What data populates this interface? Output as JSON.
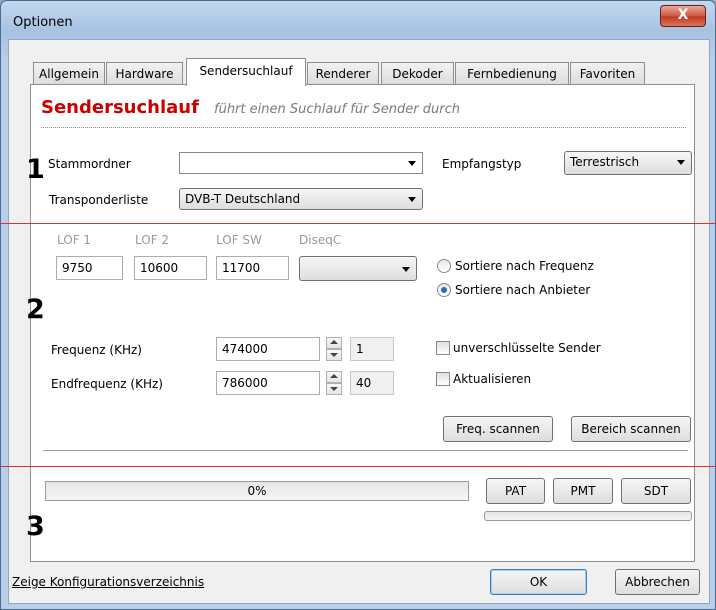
{
  "window": {
    "title": "Optionen",
    "close_glyph": "X"
  },
  "tabs": [
    {
      "label": "Allgemein"
    },
    {
      "label": "Hardware"
    },
    {
      "label": "Sendersuchlauf",
      "active": true
    },
    {
      "label": "Renderer"
    },
    {
      "label": "Dekoder"
    },
    {
      "label": "Fernbedienung"
    },
    {
      "label": "Favoriten"
    }
  ],
  "header": {
    "title": "Sendersuchlauf",
    "subtitle": "führt einen Suchlauf für Sender durch"
  },
  "section1": {
    "number": "1",
    "stammordner_label": "Stammordner",
    "stammordner_value": "",
    "transponder_label": "Transponderliste",
    "transponder_value": "DVB-T Deutschland",
    "empfangstyp_label": "Empfangstyp",
    "empfangstyp_value": "Terrestrisch"
  },
  "section2": {
    "number": "2",
    "lof1_label": "LOF 1",
    "lof1_value": "9750",
    "lof2_label": "LOF 2",
    "lof2_value": "10600",
    "lofsw_label": "LOF SW",
    "lofsw_value": "11700",
    "diseqc_label": "DiseqC",
    "diseqc_value": "",
    "sort_freq_label": "Sortiere nach Frequenz",
    "sort_anbieter_label": "Sortiere nach Anbieter",
    "sort_selected": "Sortiere nach Anbieter",
    "frequenz_label": "Frequenz (KHz)",
    "frequenz_value": "474000",
    "frequenz_channel": "1",
    "endfrequenz_label": "Endfrequenz (KHz)",
    "endfrequenz_value": "786000",
    "endfrequenz_channel": "40",
    "unverschluesselt_label": "unverschlüsselte Sender",
    "unverschluesselt_checked": false,
    "aktualisieren_label": "Aktualisieren",
    "aktualisieren_checked": false,
    "freq_scan_button": "Freq. scannen",
    "bereich_scan_button": "Bereich scannen"
  },
  "section3": {
    "number": "3",
    "progress_text": "0%",
    "progress_value": 0,
    "pat_button": "PAT",
    "pmt_button": "PMT",
    "sdt_button": "SDT"
  },
  "footer": {
    "config_link": "Zeige Konfigurationsverzeichnis",
    "ok_button": "OK",
    "cancel_button": "Abbrechen"
  },
  "colors": {
    "accent_red": "#cc0000",
    "annotation_line": "#d9303a",
    "selected_radio": "#2b6fc0"
  }
}
